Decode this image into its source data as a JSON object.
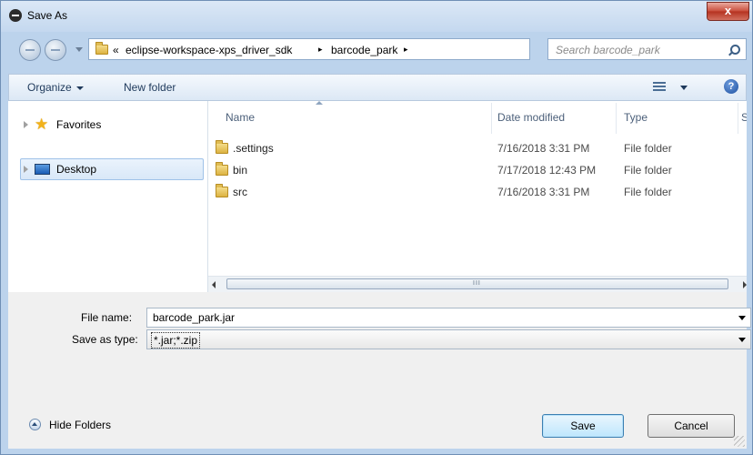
{
  "window": {
    "title": "Save As",
    "close_label": "x"
  },
  "navigation": {
    "breadcrumb_overflow": "«",
    "breadcrumb": [
      "eclipse-workspace-xps_driver_sdk",
      "barcode_park"
    ],
    "separator": "▸",
    "refresh_glyph": "⇆",
    "search_placeholder": "Search barcode_park"
  },
  "toolbar": {
    "organize_label": "Organize",
    "new_folder_label": "New folder",
    "help_glyph": "?"
  },
  "nav_pane": {
    "items": [
      {
        "label": "Favorites",
        "icon": "star-icon"
      },
      {
        "label": "Desktop",
        "icon": "desktop-icon",
        "selected": true
      }
    ]
  },
  "file_list": {
    "columns": [
      "Name",
      "Date modified",
      "Type",
      "S"
    ],
    "rows": [
      {
        "name": ".settings",
        "date_modified": "7/16/2018 3:31 PM",
        "type": "File folder"
      },
      {
        "name": "bin",
        "date_modified": "7/17/2018 12:43 PM",
        "type": "File folder"
      },
      {
        "name": "src",
        "date_modified": "7/16/2018 3:31 PM",
        "type": "File folder"
      }
    ],
    "scroll_grip": "III"
  },
  "form": {
    "file_name_label": "File name:",
    "file_name_value": "barcode_park.jar",
    "save_type_label": "Save as type:",
    "save_type_value": "*.jar;*.zip"
  },
  "footer": {
    "hide_folders_label": "Hide Folders",
    "save_label": "Save",
    "cancel_label": "Cancel"
  },
  "colors": {
    "window_frame": "#bcd3ec",
    "close_button": "#c94c3a",
    "selection": "#d9e8f8",
    "form_background": "#f0f0f0"
  }
}
